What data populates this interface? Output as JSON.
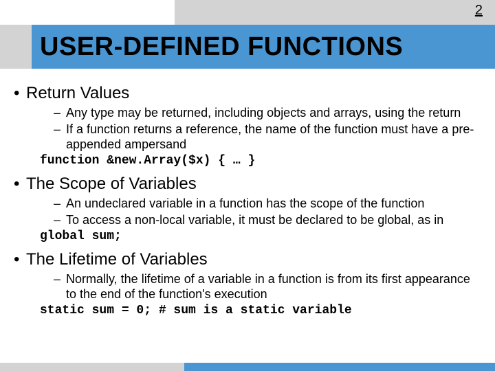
{
  "page_number": "2",
  "title": "USER-DEFINED FUNCTIONS",
  "sections": [
    {
      "heading": "Return Values",
      "items": [
        "Any type may be returned, including objects and arrays, using the return",
        "If a function returns a reference, the name of the function must have a pre-appended ampersand"
      ],
      "code": "function &new.Array($x) { … }"
    },
    {
      "heading": "The Scope of Variables",
      "items": [
        "An undeclared variable in a function has the scope of the function",
        "To access a non-local variable, it must be declared to be global, as in"
      ],
      "code": "global sum;"
    },
    {
      "heading": "The Lifetime of Variables",
      "items": [
        "Normally, the lifetime of a variable in a function is from its first appearance to the end of the function's execution"
      ],
      "code": "static sum = 0;  # sum is a static variable"
    }
  ]
}
